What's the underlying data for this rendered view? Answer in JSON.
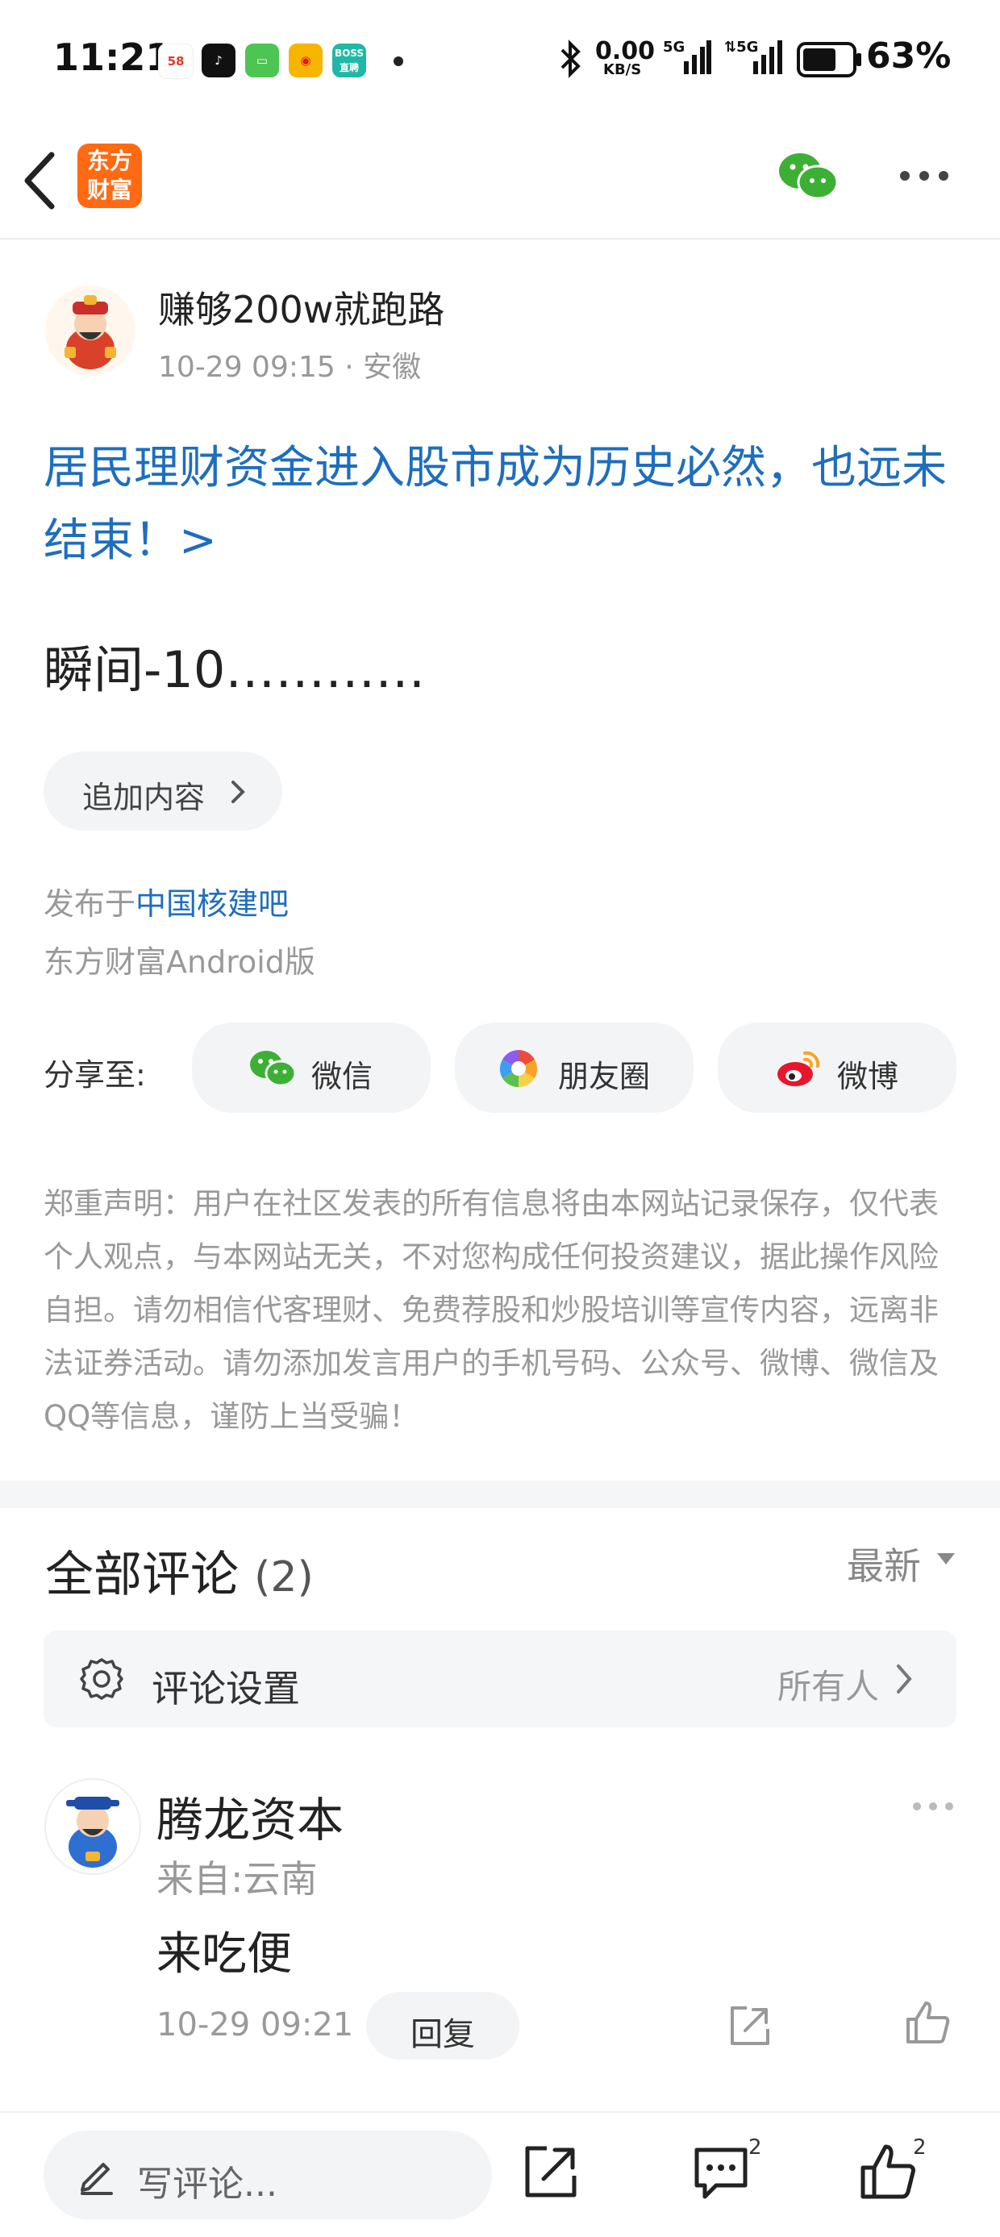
{
  "status_bar": {
    "time": "11:21",
    "app_icons": [
      "58",
      "抖音",
      "信息",
      "微博",
      "BOSS直聘"
    ],
    "network_speed": "0.00",
    "network_unit": "KB/S",
    "battery": "63%"
  },
  "navbar": {
    "logo_text_line1": "东方",
    "logo_text_line2": "财富"
  },
  "post": {
    "author": "赚够200w就跑路",
    "meta": "10-29 09:15 · 安徽",
    "headline": "居民理财资金进入股市成为历史必然，也远未结束！>",
    "body": "瞬间-10…………",
    "append_label": "追加内容",
    "published_prefix": "发布于",
    "published_board": "中国核建吧",
    "client": "东方财富Android版"
  },
  "share": {
    "label": "分享至:",
    "wechat": "微信",
    "moments": "朋友圈",
    "weibo": "微博"
  },
  "disclaimer": "郑重声明：用户在社区发表的所有信息将由本网站记录保存，仅代表个人观点，与本网站无关，不对您构成任何投资建议，据此操作风险自担。请勿相信代客理财、免费荐股和炒股培训等宣传内容，远离非法证券活动。请勿添加发言用户的手机号码、公众号、微博、微信及QQ等信息，谨防上当受骗！",
  "comments": {
    "title": "全部评论",
    "count": "(2)",
    "sort": "最新",
    "settings_label": "评论设置",
    "settings_value": "所有人",
    "items": [
      {
        "name": "腾龙资本",
        "from": "来自:云南",
        "text": "来吃便",
        "time": "10-29 09:21",
        "reply": "回复"
      }
    ]
  },
  "bottom_bar": {
    "write_placeholder": "写评论...",
    "comment_count": "2",
    "like_count": "2"
  },
  "colors": {
    "link_blue": "#1e6ebf",
    "brand_orange": "#ff6a13",
    "wechat_green": "#3cb035",
    "weibo_red": "#e6162d"
  }
}
